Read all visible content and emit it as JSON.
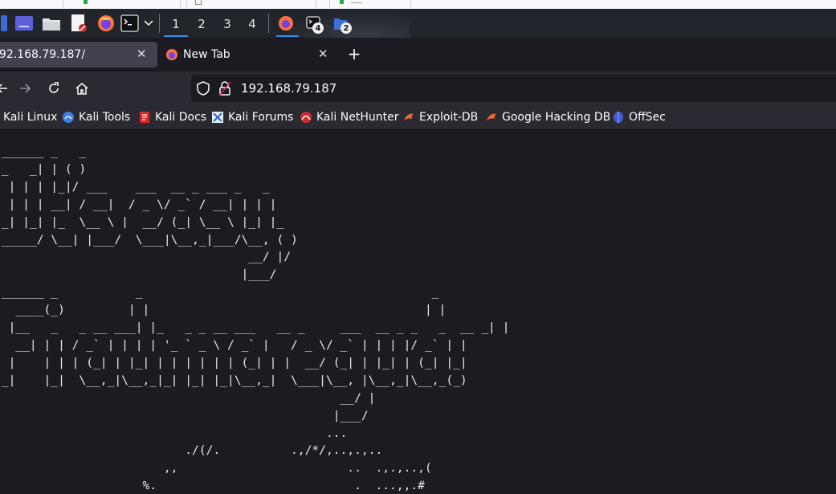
{
  "browser": {
    "tabs": [
      {
        "label": "192.168.79.187/",
        "active": true
      },
      {
        "label": "New Tab",
        "active": false
      }
    ],
    "address": "192.168.79.187",
    "bookmarks": [
      {
        "label": "Kali Linux",
        "icon": "kali-icon"
      },
      {
        "label": "Kali Tools",
        "icon": "kali-tools-icon"
      },
      {
        "label": "Kali Docs",
        "icon": "kali-docs-icon"
      },
      {
        "label": "Kali Forums",
        "icon": "kali-forums-icon"
      },
      {
        "label": "Kali NetHunter",
        "icon": "nethunter-icon"
      },
      {
        "label": "Exploit-DB",
        "icon": "exploit-db-icon"
      },
      {
        "label": "Google Hacking DB",
        "icon": "ghdb-icon"
      },
      {
        "label": "OffSec",
        "icon": "offsec-icon"
      }
    ]
  },
  "panel": {
    "workspaces": [
      "1",
      "2",
      "3",
      "4"
    ],
    "active_workspace": "1",
    "terminal_badge": "4",
    "files_badge": "2"
  },
  "page": {
    "ascii_art": " ______ _   _\n|_   _| | ( )\n  | | | |_|/ ___    ___  __ _ ___ _   _\n  | | | __| / __|  / _ \\/ _` / __| | | |\n _| |_| |_  \\__ \\ |  __/ (_| \\__ \\ |_| |_\n|_____/ \\__| |___/  \\___|\\__,_|___/\\__, ( )\n                                    __/ |/\n                                   |___/\n ______ _           _                                         _\n|  ____(_)         | |                                       | |\n| |__   _   _ __ ___| |_   _ _ __ ___   __ _     ___  __ _ _   _  __ _| |\n|  __| | | / _` | | | | '_ ` _ \\ / _` |   / _ \\/ _` | | | |/ _` | |\n| |    | | | (_| | |_| | | | | | | (_| | |  __/ (_| | |_| | (_| |_|\n|_|    |_|  \\__,_|\\__,_|_| |_| |_|\\__,_|  \\___|\\__, |\\__,_|\\__,_(_)\n                                                 __/ |\n                                                |___/\n                                               ...\n                           ./(/.          .,/*/,..,.,..\n                        ,,                        ..  .,.,..,(\n                     %.                            .  ...,,.#"
  }
}
